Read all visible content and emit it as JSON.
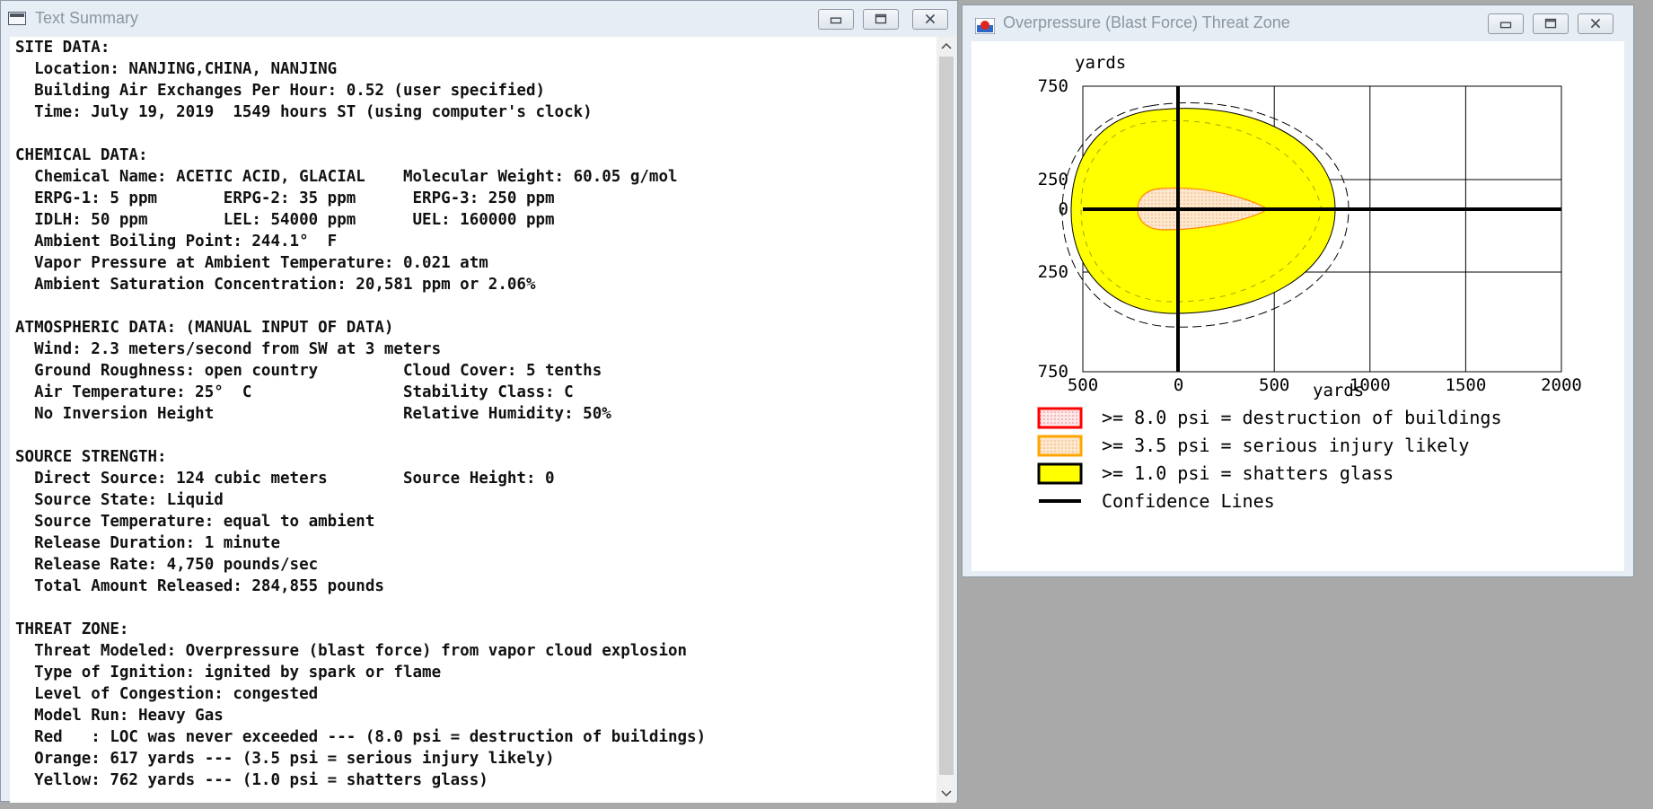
{
  "summary_window": {
    "title": "Text Summary",
    "controls": {
      "minimize": "minimize-icon",
      "maximize": "maximize-icon",
      "close": "close-icon"
    },
    "lines": [
      "SITE DATA:",
      "  Location: NANJING,CHINA, NANJING",
      "  Building Air Exchanges Per Hour: 0.52 (user specified)",
      "  Time: July 19, 2019  1549 hours ST (using computer's clock)",
      "",
      "CHEMICAL DATA:",
      "  Chemical Name: ACETIC ACID, GLACIAL    Molecular Weight: 60.05 g/mol",
      "  ERPG-1: 5 ppm       ERPG-2: 35 ppm      ERPG-3: 250 ppm",
      "  IDLH: 50 ppm        LEL: 54000 ppm      UEL: 160000 ppm",
      "  Ambient Boiling Point: 244.1°  F",
      "  Vapor Pressure at Ambient Temperature: 0.021 atm",
      "  Ambient Saturation Concentration: 20,581 ppm or 2.06%",
      "",
      "ATMOSPHERIC DATA: (MANUAL INPUT OF DATA)",
      "  Wind: 2.3 meters/second from SW at 3 meters",
      "  Ground Roughness: open country         Cloud Cover: 5 tenths",
      "  Air Temperature: 25°  C                Stability Class: C",
      "  No Inversion Height                    Relative Humidity: 50%",
      "",
      "SOURCE STRENGTH:",
      "  Direct Source: 124 cubic meters        Source Height: 0",
      "  Source State: Liquid",
      "  Source Temperature: equal to ambient",
      "  Release Duration: 1 minute",
      "  Release Rate: 4,750 pounds/sec",
      "  Total Amount Released: 284,855 pounds",
      "",
      "THREAT ZONE:",
      "  Threat Modeled: Overpressure (blast force) from vapor cloud explosion",
      "  Type of Ignition: ignited by spark or flame",
      "  Level of Congestion: congested",
      "  Model Run: Heavy Gas",
      "  Red   : LOC was never exceeded --- (8.0 psi = destruction of buildings)",
      "  Orange: 617 yards --- (3.5 psi = serious injury likely)",
      "  Yellow: 762 yards --- (1.0 psi = shatters glass)"
    ],
    "scroll": {
      "up": "chevron-up-icon",
      "down": "chevron-down-icon"
    }
  },
  "threat_window": {
    "title": "Overpressure (Blast Force) Threat Zone",
    "controls": {
      "minimize": "minimize-icon",
      "maximize": "maximize-icon",
      "close": "close-icon"
    }
  },
  "chart_data": {
    "type": "area",
    "xlabel": "yards",
    "ylabel": "yards",
    "x_tick_labels": [
      "500",
      "0",
      "500",
      "1000",
      "1500",
      "2000"
    ],
    "y_tick_labels": [
      "750",
      "250",
      "0",
      "250",
      "750"
    ],
    "xlim": [
      -500,
      2000
    ],
    "ylim": [
      -750,
      750
    ],
    "grid": true,
    "legend_position": "bottom",
    "legend": [
      {
        "label": ">= 8.0 psi = destruction of buildings",
        "color": "#ff0000"
      },
      {
        "label": ">= 3.5 psi = serious injury likely",
        "color": "#ffa500"
      },
      {
        "label": ">= 1.0 psi = shatters glass",
        "color": "#ffff00"
      },
      {
        "label": "Confidence Lines",
        "color": "#000000"
      }
    ],
    "zones": [
      {
        "name": "Orange",
        "threshold_psi": 3.5,
        "extent_yards": 617
      },
      {
        "name": "Yellow",
        "threshold_psi": 1.0,
        "extent_yards": 762
      }
    ]
  }
}
